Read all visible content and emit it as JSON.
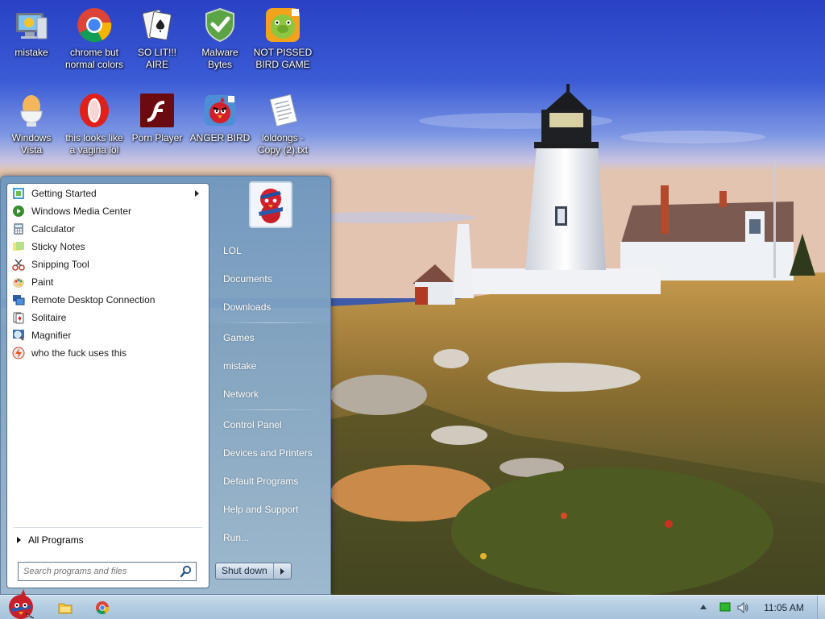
{
  "desktop_icons": [
    {
      "label": "mistake",
      "icon": "computer-icon"
    },
    {
      "label": "chrome but normal colors",
      "icon": "chrome-icon"
    },
    {
      "label": "SO LIT!!! AIRE",
      "icon": "solitaire-cards-icon"
    },
    {
      "label": "Malware Bytes",
      "icon": "shield-check-icon"
    },
    {
      "label": "NOT PISSED BIRD GAME",
      "icon": "green-pig-icon"
    },
    {
      "label": "Windows Vista",
      "icon": "egg-cup-icon"
    },
    {
      "label": "this looks like a vagina lol",
      "icon": "opera-icon"
    },
    {
      "label": "Porn Player",
      "icon": "flash-player-icon"
    },
    {
      "label": "ANGER BIRD",
      "icon": "red-bird-icon"
    },
    {
      "label": "loldongs - Copy (2).txt",
      "icon": "text-document-icon"
    }
  ],
  "start_menu": {
    "programs": [
      {
        "label": "Getting Started",
        "icon": "getting-started-icon",
        "has_submenu": true
      },
      {
        "label": "Windows Media Center",
        "icon": "media-center-icon"
      },
      {
        "label": "Calculator",
        "icon": "calculator-icon"
      },
      {
        "label": "Sticky Notes",
        "icon": "sticky-notes-icon"
      },
      {
        "label": "Snipping Tool",
        "icon": "scissors-icon"
      },
      {
        "label": "Paint",
        "icon": "paint-palette-icon"
      },
      {
        "label": "Remote Desktop Connection",
        "icon": "remote-desktop-icon"
      },
      {
        "label": "Solitaire",
        "icon": "solitaire-icon"
      },
      {
        "label": "Magnifier",
        "icon": "magnifier-icon"
      },
      {
        "label": "who the fuck uses this",
        "icon": "flash-icon"
      }
    ],
    "all_programs": "All Programs",
    "search_placeholder": "Search programs and files",
    "places": [
      {
        "label": "LOL"
      },
      {
        "label": "Documents"
      },
      {
        "label": "Downloads"
      },
      {
        "label": "Games"
      },
      {
        "label": "mistake"
      },
      {
        "label": "Network"
      },
      {
        "label": "Control Panel"
      },
      {
        "label": "Devices and Printers"
      },
      {
        "label": "Default Programs"
      },
      {
        "label": "Help and Support"
      },
      {
        "label": "Run..."
      }
    ],
    "shutdown_label": "Shut down"
  },
  "taskbar": {
    "clock": "11:05 AM",
    "pinned": [
      {
        "icon": "folder-icon"
      },
      {
        "icon": "chrome-icon"
      }
    ]
  },
  "colors": {
    "accent": "#5d7fa3",
    "taskbar": "#b5cde2"
  }
}
